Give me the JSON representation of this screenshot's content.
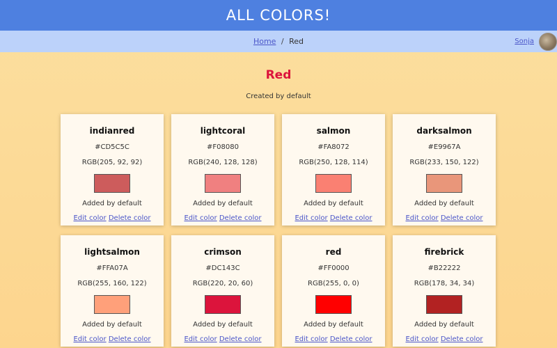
{
  "header": {
    "title": "ALL COLORS!"
  },
  "nav": {
    "breadcrumb": {
      "home": "Home",
      "separator": "/",
      "current": "Red"
    },
    "user": {
      "name": "Sonja"
    }
  },
  "page": {
    "heading": "Red",
    "heading_color": "#DC143C",
    "subtitle": "Created by default"
  },
  "colors": [
    {
      "name": "indianred",
      "hex": "#CD5C5C",
      "rgb": "RGB(205, 92, 92)",
      "added": "Added by default",
      "edit": "Edit color",
      "delete": "Delete color"
    },
    {
      "name": "lightcoral",
      "hex": "#F08080",
      "rgb": "RGB(240, 128, 128)",
      "added": "Added by default",
      "edit": "Edit color",
      "delete": "Delete color"
    },
    {
      "name": "salmon",
      "hex": "#FA8072",
      "rgb": "RGB(250, 128, 114)",
      "added": "Added by default",
      "edit": "Edit color",
      "delete": "Delete color"
    },
    {
      "name": "darksalmon",
      "hex": "#E9967A",
      "rgb": "RGB(233, 150, 122)",
      "added": "Added by default",
      "edit": "Edit color",
      "delete": "Delete color"
    },
    {
      "name": "lightsalmon",
      "hex": "#FFA07A",
      "rgb": "RGB(255, 160, 122)",
      "added": "Added by default",
      "edit": "Edit color",
      "delete": "Delete color"
    },
    {
      "name": "crimson",
      "hex": "#DC143C",
      "rgb": "RGB(220, 20, 60)",
      "added": "Added by default",
      "edit": "Edit color",
      "delete": "Delete color"
    },
    {
      "name": "red",
      "hex": "#FF0000",
      "rgb": "RGB(255, 0, 0)",
      "added": "Added by default",
      "edit": "Edit color",
      "delete": "Delete color"
    },
    {
      "name": "firebrick",
      "hex": "#B22222",
      "rgb": "RGB(178, 34, 34)",
      "added": "Added by default",
      "edit": "Edit color",
      "delete": "Delete color"
    }
  ]
}
